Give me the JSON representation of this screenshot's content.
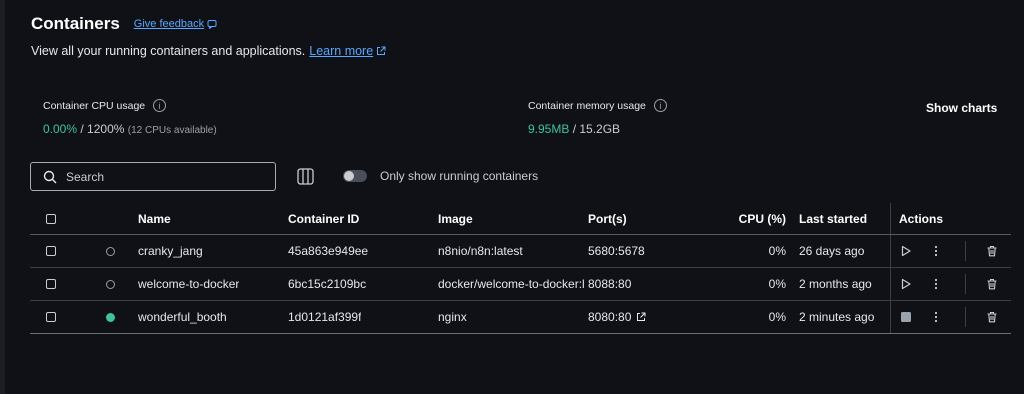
{
  "header": {
    "title": "Containers",
    "feedback": "Give feedback",
    "subtitle": "View all your running containers and applications.",
    "learn_more": "Learn more"
  },
  "stats": {
    "cpu": {
      "label": "Container CPU usage",
      "value": "0.00%",
      "max": "/ 1200%",
      "note": "(12 CPUs available)"
    },
    "memory": {
      "label": "Container memory usage",
      "value": "9.95MB",
      "max": "/ 15.2GB"
    },
    "show_charts": "Show charts"
  },
  "search": {
    "placeholder": "Search"
  },
  "toggle": {
    "label": "Only show running containers",
    "on": false
  },
  "table": {
    "columns": [
      "Name",
      "Container ID",
      "Image",
      "Port(s)",
      "CPU (%)",
      "Last started",
      "Actions"
    ],
    "rows": [
      {
        "name": "cranky_jang",
        "id": "45a863e949ee",
        "image": "n8nio/n8n:latest",
        "port": "5680:5678",
        "cpu": "0%",
        "last": "26 days ago",
        "running": false
      },
      {
        "name": "welcome-to-docker",
        "id": "6bc15c2109bc",
        "image": "docker/welcome-to-docker:l",
        "port": "8088:80",
        "cpu": "0%",
        "last": "2 months ago",
        "running": false
      },
      {
        "name": "wonderful_booth",
        "id": "1d0121af399f",
        "image": "nginx",
        "port": "8080:80",
        "cpu": "0%",
        "last": "2 minutes ago",
        "running": true
      }
    ]
  },
  "colors": {
    "accent_green": "#3fc2a0",
    "link_blue": "#5aa7ff",
    "background": "#0f1116"
  },
  "icons": [
    "info-icon",
    "search-icon",
    "columns-icon",
    "external-link-icon",
    "play-icon",
    "stop-icon",
    "more-icon",
    "trash-icon",
    "feedback-icon"
  ]
}
